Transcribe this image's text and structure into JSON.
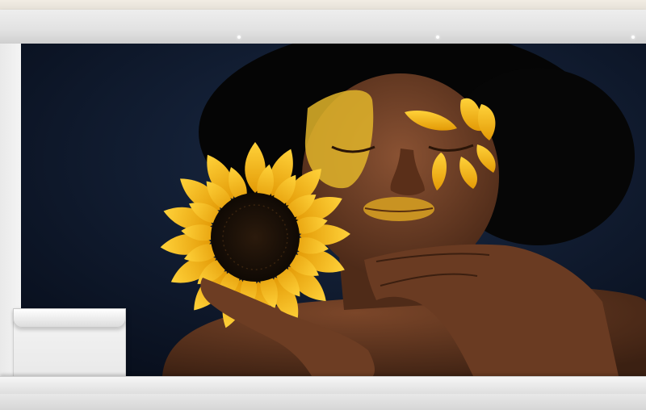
{
  "scene": {
    "description_colors": {
      "backdrop": "#0c1628",
      "skin": "#6a3c25",
      "gold": "#e2b52a",
      "sunflower": "#f5b915"
    }
  }
}
